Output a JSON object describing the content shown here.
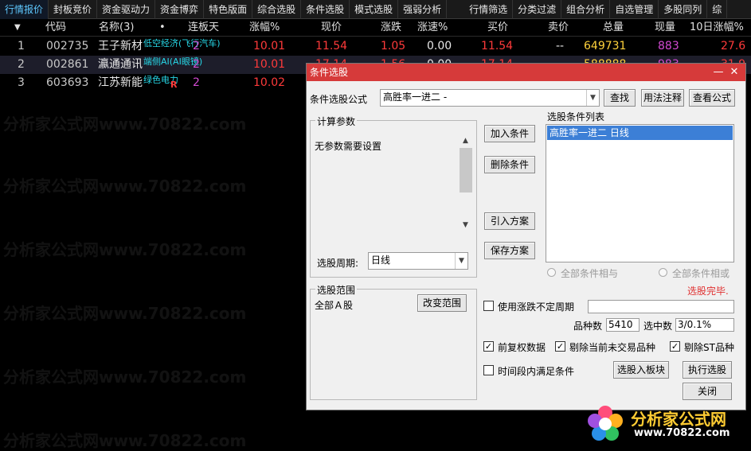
{
  "tabs": [
    "行情报价",
    "封板竞价",
    "资金驱动力",
    "资金博弈",
    "特色版面",
    "综合选股",
    "条件选股",
    "模式选股",
    "强弱分析",
    "行情筛选",
    "分类过滤",
    "组合分析",
    "自选管理",
    "多股同列",
    "综"
  ],
  "columns": {
    "sort_arrow": "▼",
    "code": "代码",
    "name": "名称(3)",
    "dot": "•",
    "streak": "连板天",
    "pct": "涨幅%",
    "price": "现价",
    "change": "涨跌",
    "speed": "涨速%",
    "buy": "买价",
    "sell": "卖价",
    "volume": "总量",
    "current_vol": "现量",
    "ten_day": "10日涨幅%"
  },
  "rows": [
    {
      "idx": "1",
      "code": "002735",
      "name": "王子新材",
      "tag": "低空经济(飞行汽车)",
      "streak": "2",
      "pct": "10.01",
      "price": "11.54",
      "change": "1.05",
      "speed": "0.00",
      "buy": "11.54",
      "sell": "--",
      "volume": "649731",
      "current_vol": "883",
      "ten_day": "27.6"
    },
    {
      "idx": "2",
      "code": "002861",
      "name": "瀛通通讯",
      "tag": "端侧AI(AI眼镜)",
      "streak": "2",
      "pct": "10.01",
      "price": "17.14",
      "change": "1.56",
      "speed": "0.00",
      "buy": "17.14",
      "sell": "--",
      "volume": "588888",
      "current_vol": "983",
      "ten_day": "31.9"
    },
    {
      "idx": "3",
      "code": "603693",
      "name": "江苏新能",
      "tag": "绿色电力",
      "badge": "R",
      "streak": "2",
      "pct": "10.02",
      "price": "",
      "change": "",
      "speed": "",
      "buy": "",
      "sell": "",
      "volume": "",
      "current_vol": "",
      "ten_day": ""
    }
  ],
  "watermark": "分析家公式网www.70822.com",
  "dialog": {
    "title": "条件选股",
    "minimize": "—",
    "close": "✕",
    "formula_label": "条件选股公式",
    "formula_value": "高胜率一进二  -",
    "btn_find": "查找",
    "btn_usage": "用法注释",
    "btn_view": "查看公式",
    "params_title": "计算参数",
    "params_text": "无参数需要设置",
    "period_label": "选股周期:",
    "period_value": "日线",
    "btn_add": "加入条件",
    "btn_delete": "删除条件",
    "btn_import": "引入方案",
    "btn_save": "保存方案",
    "cond_list_title": "选股条件列表",
    "cond_items": [
      "高胜率一进二  日线"
    ],
    "radio_and": "全部条件相与",
    "radio_or": "全部条件相或",
    "status": "选股完毕.",
    "scope_title": "选股范围",
    "scope_value": "全部Ａ股",
    "btn_change_scope": "改变范围",
    "use_period_label": "使用涨跌不定周期",
    "count_label": "品种数",
    "count_value": "5410",
    "selected_label": "选中数",
    "selected_value": "3/0.1%",
    "chk_adjust": "前复权数据",
    "chk_exclude_untraded": "剔除当前未交易品种",
    "chk_exclude_st": "剔除ST品种",
    "chk_timerange": "时间段内满足条件",
    "btn_to_block": "选股入板块",
    "btn_execute": "执行选股",
    "btn_close": "关闭"
  },
  "logo": {
    "text": "分析家公式网",
    "url": "www.70822.com"
  },
  "colors": {
    "dialog_title": "#d63a3a",
    "up": "#ff3a3a",
    "volume": "#ffd23c",
    "current_vol": "#d24ad2",
    "tag": "#27d8e8",
    "active_tab": "#5ec8ff"
  }
}
